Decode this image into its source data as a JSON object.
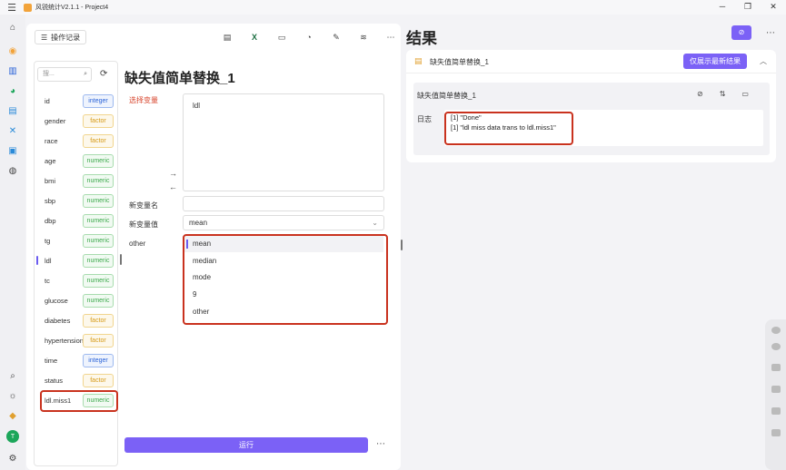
{
  "app": {
    "title": "风锐统计V2.1.1 - Project4"
  },
  "toolbar": {
    "history_label": "操作记录"
  },
  "varlist": {
    "search_placeholder": "搜...",
    "items": [
      {
        "name": "id",
        "type": "integer"
      },
      {
        "name": "gender",
        "type": "factor"
      },
      {
        "name": "race",
        "type": "factor"
      },
      {
        "name": "age",
        "type": "numeric"
      },
      {
        "name": "bmi",
        "type": "numeric"
      },
      {
        "name": "sbp",
        "type": "numeric"
      },
      {
        "name": "dbp",
        "type": "numeric"
      },
      {
        "name": "tg",
        "type": "numeric"
      },
      {
        "name": "ldl",
        "type": "numeric"
      },
      {
        "name": "tc",
        "type": "numeric"
      },
      {
        "name": "glucose",
        "type": "numeric"
      },
      {
        "name": "diabetes",
        "type": "factor"
      },
      {
        "name": "hypertension",
        "type": "factor"
      },
      {
        "name": "time",
        "type": "integer"
      },
      {
        "name": "status",
        "type": "factor"
      },
      {
        "name": "ldl.miss1",
        "type": "numeric"
      }
    ]
  },
  "dialog": {
    "title": "缺失值简单替换_1",
    "select_var_label": "选择变量",
    "selected_var": "ldl",
    "new_var_name_label": "新变量名",
    "new_var_name_value": "",
    "new_var_value_label": "新变量值",
    "new_var_value": "mean",
    "other_label": "other",
    "options": [
      "mean",
      "median",
      "mode",
      "9",
      "other"
    ],
    "run_label": "运行"
  },
  "results": {
    "title": "结果",
    "header_name": "缺失值简单替换_1",
    "latest_only_label": "仅展示最新结果",
    "card_title": "缺失值简单替换_1",
    "log_label": "日志",
    "log_lines": [
      "[1] \"Done\"",
      "[1] \"ldl miss data trans to  ldl.miss1\""
    ]
  },
  "colors": {
    "accent": "#7b61f6",
    "highlight_box": "#c9321e"
  }
}
